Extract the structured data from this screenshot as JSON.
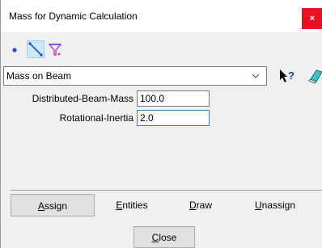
{
  "window": {
    "title": "Mass for Dynamic Calculation",
    "close_glyph": "×"
  },
  "toolbar": {
    "tools": [
      {
        "icon": "point-icon",
        "selected": false
      },
      {
        "icon": "line-icon",
        "selected": true
      },
      {
        "icon": "filter-icon",
        "selected": false
      }
    ]
  },
  "mass_type": {
    "selected": "Mass on Beam"
  },
  "fields": [
    {
      "label": "Distributed-Beam-Mass",
      "value": "100.0"
    },
    {
      "label": "Rotational-Inertia",
      "value": "2.0"
    }
  ],
  "actions": {
    "assign": {
      "mnemonic": "A",
      "rest": "ssign"
    },
    "entities": {
      "mnemonic": "E",
      "rest": "ntities"
    },
    "draw": {
      "mnemonic": "D",
      "rest": "raw"
    },
    "unassign": {
      "mnemonic": "U",
      "rest": "nassign"
    }
  },
  "close_button": {
    "mnemonic": "C",
    "rest": "lose"
  },
  "colors": {
    "close_bg": "#e81123",
    "accent": "#3c7fb1",
    "selected_tool": "#cce8ff"
  }
}
